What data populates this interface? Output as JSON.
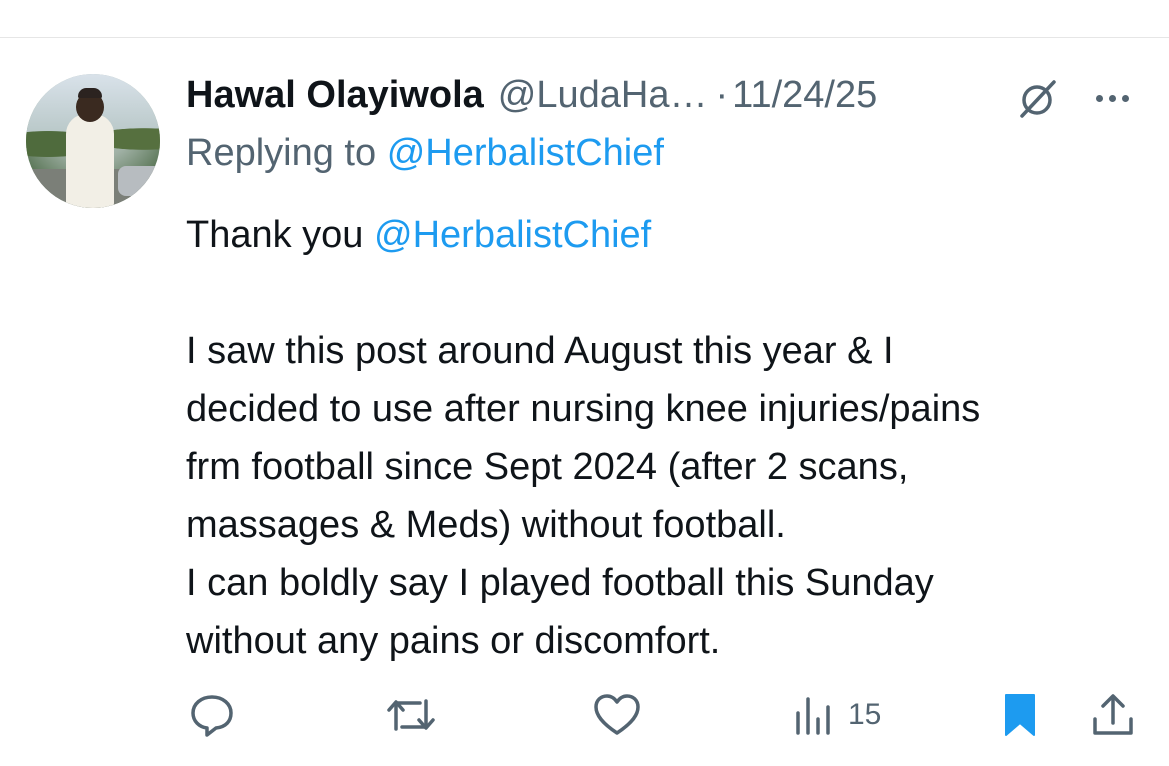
{
  "tweet": {
    "display_name": "Hawal Olayiwola",
    "handle": "@LudaHa…",
    "separator": "·",
    "date": "11/24/25",
    "replying_prefix": "Replying to",
    "replying_to": "@HerbalistChief",
    "body": {
      "thank_prefix": "Thank you",
      "thank_mention": "@HerbalistChief",
      "lines": [
        "I saw this post around August this year & I",
        "decided to use after nursing knee injuries/pains",
        "frm football since Sept 2024 (after 2 scans,",
        "massages & Meds) without football.",
        "I can boldly say I played football this Sunday",
        "without any pains or discomfort."
      ]
    },
    "actions": {
      "views": "15"
    }
  },
  "colors": {
    "text": "#0f1419",
    "muted": "#536471",
    "link": "#1d9bf0",
    "bookmark": "#1d9bf0"
  },
  "icons": [
    "grok-icon",
    "more-icon",
    "reply-icon",
    "retweet-icon",
    "like-icon",
    "views-icon",
    "bookmark-icon",
    "share-icon"
  ]
}
